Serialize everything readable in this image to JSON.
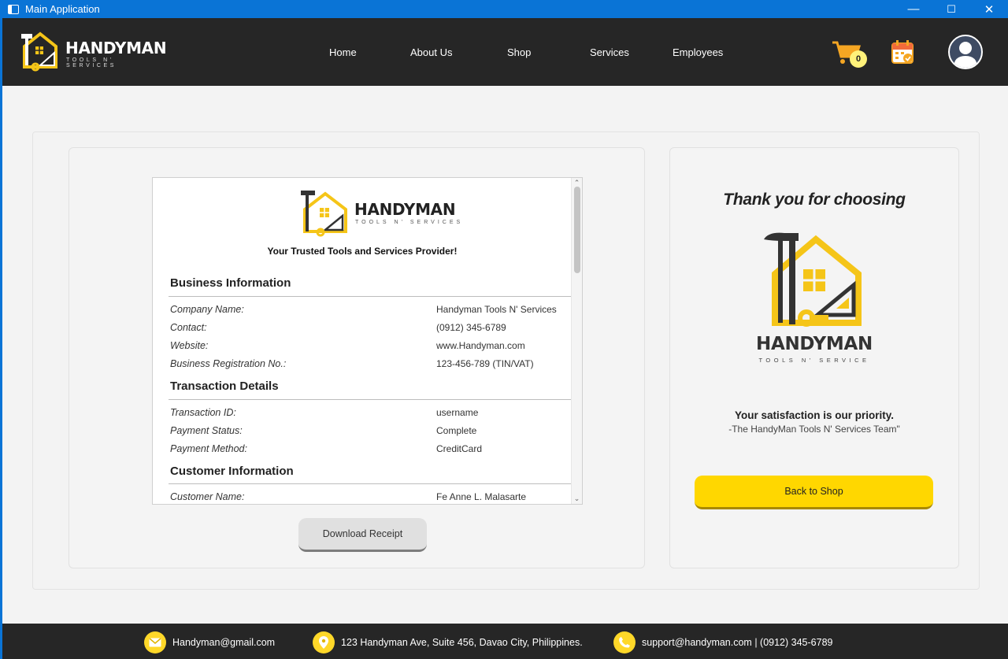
{
  "window": {
    "title": "Main Application",
    "minimize": "—",
    "maximize": "☐",
    "close": "✕"
  },
  "brand": {
    "name": "HANDYMAN",
    "tagline": "TOOLS N' SERVICES"
  },
  "nav": {
    "items": [
      "Home",
      "About Us",
      "Shop",
      "Services",
      "Employees"
    ],
    "cart_count": "0"
  },
  "receipt": {
    "brand_name": "HANDYMAN",
    "brand_tagline": "TOOLS N' SERVICES",
    "slogan": "Your Trusted Tools and Services Provider!",
    "sections": [
      {
        "title": "Business Information",
        "rows": [
          {
            "label": "Company Name:",
            "value": "Handyman Tools N' Services"
          },
          {
            "label": "Contact:",
            "value": "(0912) 345-6789"
          },
          {
            "label": "Website:",
            "value": "www.Handyman.com"
          },
          {
            "label": "Business Registration No.:",
            "value": "123-456-789 (TIN/VAT)"
          }
        ]
      },
      {
        "title": "Transaction Details",
        "rows": [
          {
            "label": "Transaction ID:",
            "value": "username"
          },
          {
            "label": "Payment Status:",
            "value": "Complete"
          },
          {
            "label": "Payment Method:",
            "value": "CreditCard"
          }
        ]
      },
      {
        "title": "Customer Information",
        "rows": [
          {
            "label": "Customer Name:",
            "value": "Fe Anne L. Malasarte"
          }
        ]
      }
    ]
  },
  "download_button": "Download Receipt",
  "thank_you": {
    "heading": "Thank you for choosing",
    "brand_name": "HANDYMAN",
    "brand_tagline": "TOOLS N' SERVICE",
    "satisfaction": "Your satisfaction is our priority.",
    "signature": "-The HandyMan Tools N' Services Team\"",
    "back_button": "Back to Shop"
  },
  "footer": {
    "email": "Handyman@gmail.com",
    "address": "123 Handyman Ave, Suite 456, Davao City, Philippines.",
    "support": "support@handyman.com | (0912) 345-6789"
  },
  "colors": {
    "accent": "#ffd700",
    "navbar": "#262626",
    "titlebar": "#0a74d6"
  }
}
